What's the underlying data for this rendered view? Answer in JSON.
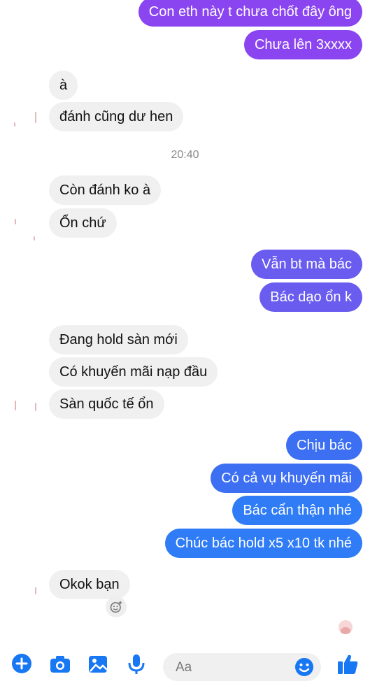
{
  "conversation": {
    "timestamp": "20:40",
    "messages": [
      {
        "id": "m1",
        "side": "out",
        "text": "Con eth này t chưa chốt đây ông"
      },
      {
        "id": "m2",
        "side": "out",
        "text": "Chưa lên 3xxxx"
      },
      {
        "id": "m3",
        "side": "in",
        "text": "à"
      },
      {
        "id": "m4",
        "side": "in",
        "text": "đánh cũng dư hen"
      },
      {
        "id": "m5",
        "side": "in",
        "text": "Còn đánh ko à"
      },
      {
        "id": "m6",
        "side": "in",
        "text": "Ổn chứ"
      },
      {
        "id": "m7",
        "side": "out",
        "text": "Vẫn bt mà bác"
      },
      {
        "id": "m8",
        "side": "out",
        "text": "Bác dạo ổn k"
      },
      {
        "id": "m9",
        "side": "in",
        "text": "Đang hold sàn mới"
      },
      {
        "id": "m10",
        "side": "in",
        "text": "Có khuyến mãi nạp đầu"
      },
      {
        "id": "m11",
        "side": "in",
        "text": "Sàn quốc tế ổn"
      },
      {
        "id": "m12",
        "side": "out",
        "text": "Chịu bác"
      },
      {
        "id": "m13",
        "side": "out",
        "text": "Có cả vụ khuyến mãi"
      },
      {
        "id": "m14",
        "side": "out",
        "text": "Bác cẩn thận nhé"
      },
      {
        "id": "m15",
        "side": "out",
        "text": "Chúc bác hold x5 x10 tk nhé"
      },
      {
        "id": "m16",
        "side": "in",
        "text": "Okok bạn"
      }
    ]
  },
  "composer": {
    "placeholder": "Aa",
    "icons": [
      "plus-icon",
      "camera-icon",
      "image-icon",
      "microphone-icon",
      "emoji-icon",
      "thumbs-up-icon"
    ]
  },
  "colors": {
    "outgoing_top": "#8a45f0",
    "outgoing_bottom": "#2f7cf6",
    "incoming": "#f0f0f0",
    "accent": "#1877f2"
  }
}
